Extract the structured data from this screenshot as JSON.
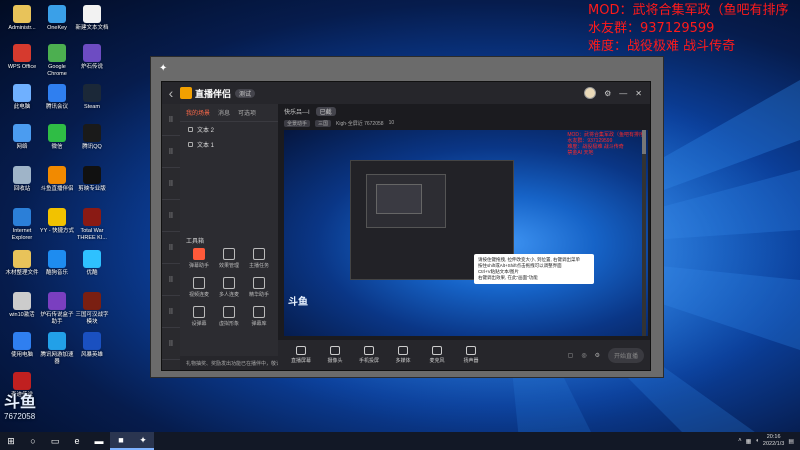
{
  "overlay": {
    "lines": [
      "MOD：武将合集军政（鱼吧有排序",
      "水友群：937129599",
      "难度：战役极难 战斗传奇",
      "禁金AI 天地"
    ]
  },
  "desktop_icons": [
    {
      "label": "Administr...",
      "color": "#e8c35a"
    },
    {
      "label": "OneKey",
      "color": "#3aa0e8"
    },
    {
      "label": "新建文本文档",
      "color": "#f2f2f2"
    },
    {
      "label": "WPS Office",
      "color": "#d63a2e"
    },
    {
      "label": "Google Chrome",
      "color": "#4caf50"
    },
    {
      "label": "炉石传说",
      "color": "#6d4cc2"
    },
    {
      "label": "此电脑",
      "color": "#6fb0ff"
    },
    {
      "label": "腾讯会议",
      "color": "#2f7ff0"
    },
    {
      "label": "Steam",
      "color": "#1b2838"
    },
    {
      "label": "网络",
      "color": "#4b9cf0"
    },
    {
      "label": "微信",
      "color": "#2fbd45"
    },
    {
      "label": "腾讯QQ",
      "color": "#1a1a1a"
    },
    {
      "label": "回收站",
      "color": "#9fb4c8"
    },
    {
      "label": "斗鱼直播伴侣",
      "color": "#f28a00"
    },
    {
      "label": "剪映专业版",
      "color": "#111111"
    },
    {
      "label": "Internet Explorer",
      "color": "#2b7fd8"
    },
    {
      "label": "YY - 快捷方式",
      "color": "#f2c200"
    },
    {
      "label": "Total War THREE KI...",
      "color": "#8a1a14"
    },
    {
      "label": "木材整理文件",
      "color": "#e8c35a"
    },
    {
      "label": "酷狗音乐",
      "color": "#1e8cf0"
    },
    {
      "label": "优酷",
      "color": "#2ec1ff"
    },
    {
      "label": "win10激活",
      "color": "#cccccc"
    },
    {
      "label": "炉石传说盒子助手",
      "color": "#7a3fc0"
    },
    {
      "label": "三国可汉战字模块",
      "color": "#7a1f12"
    },
    {
      "label": "使用电脑",
      "color": "#2f7ff0"
    },
    {
      "label": "腾讯网游加速器",
      "color": "#22a0e8"
    },
    {
      "label": "风暴英雄",
      "color": "#1a50c0"
    },
    {
      "label": "奇迹传说",
      "color": "#c02020"
    }
  ],
  "app": {
    "logo": "直播伴侣",
    "version": "测试",
    "left_tabs": [
      "我的场景",
      "消息",
      "可选项"
    ],
    "sources": [
      "文本 2",
      "文本 1"
    ],
    "tools_title": "工具箱",
    "tools": [
      {
        "label": "弹幕助手",
        "hot": true
      },
      {
        "label": "效果管理",
        "hot": false
      },
      {
        "label": "主播任务",
        "hot": false
      },
      {
        "label": "视频连麦",
        "hot": false
      },
      {
        "label": "多人连麦",
        "hot": false
      },
      {
        "label": "精华助手",
        "hot": false
      },
      {
        "label": "设弹幕",
        "hot": false
      },
      {
        "label": "虚拟形象",
        "hot": false
      },
      {
        "label": "弹幕库",
        "hot": false
      }
    ],
    "footer_note": "礼物抽奖、奖励发出功能已在播伴中，敬请期待",
    "main_head": {
      "title": "快乐吕---I",
      "badge": "已截",
      "tags": [
        "全景动手",
        "三国"
      ],
      "id": "Kigh·全屏近 7672058",
      "count": "10"
    },
    "preview_overlay": [
      "MOD：武将合集军政（鱼吧有排序",
      "水友群：937129599",
      "难度：战役极难 战斗传奇",
      "禁金AI 天地"
    ],
    "tooltip": "请按住键拖拽, 拉伸改变大小, 到位置, 右键调出菜单\n按住shift或Alt+Shift点击拖拽可以调整界面\nCtrl+V粘贴文本/图片\n右键调出效果, 在此\"画面\"功能",
    "preview_logo": "斗鱼",
    "bottom_items": [
      "直播屏幕",
      "摄像头",
      "手机投屏",
      "多媒体",
      "麦克风",
      "扬声器"
    ],
    "start_label": "开始直播"
  },
  "watermark": {
    "brand": "斗鱼",
    "room": "7672058"
  },
  "taskbar": {
    "time": "20:16",
    "date": "2022/1/3"
  }
}
